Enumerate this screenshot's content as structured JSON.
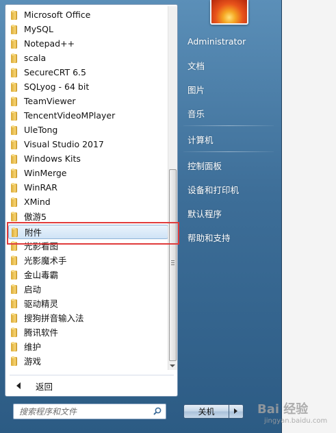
{
  "programs": [
    "Microsoft Office",
    "MySQL",
    "Notepad++",
    "scala",
    "SecureCRT 6.5",
    "SQLyog - 64 bit",
    "TeamViewer",
    "TencentVideoMPlayer",
    "UleTong",
    "Visual Studio 2017",
    "Windows Kits",
    "WinMerge",
    "WinRAR",
    "XMind",
    "傲游5",
    "附件",
    "光影看图",
    "光影魔术手",
    "金山毒霸",
    "启动",
    "驱动精灵",
    "搜狗拼音输入法",
    "腾讯软件",
    "维护",
    "游戏"
  ],
  "selected_program": "附件",
  "back_label": "返回",
  "search": {
    "placeholder": "搜索程序和文件"
  },
  "right_panel": {
    "user": "Administrator",
    "documents": "文档",
    "pictures": "图片",
    "music": "音乐",
    "computer": "计算机",
    "control_panel": "控制面板",
    "devices_printers": "设备和打印机",
    "default_programs": "默认程序",
    "help_support": "帮助和支持"
  },
  "shutdown_label": "关机",
  "watermark": {
    "logo": "Bai 经验",
    "sub": "jingyan.baidu.com"
  },
  "colors": {
    "frame": "#3d6e98",
    "highlight_annotation": "#e03b3b",
    "selected_item": "#cfe3f6"
  },
  "icons": {
    "program_folder": "folder-icon",
    "back": "back-arrow-icon",
    "search": "search-icon",
    "shutdown_menu": "triangle-right-icon"
  }
}
